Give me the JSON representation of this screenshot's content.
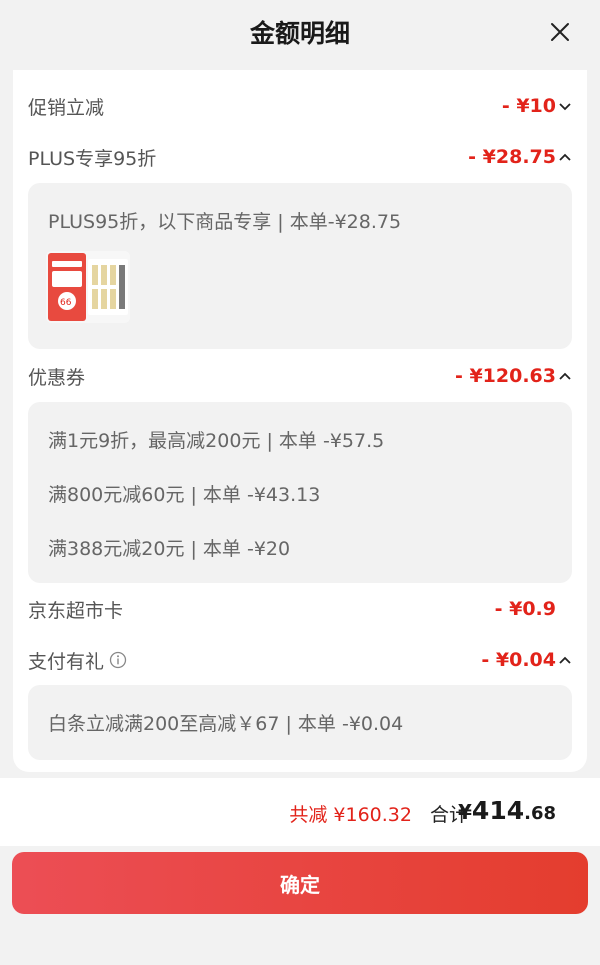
{
  "header": {
    "title": "金额明细",
    "close_icon": "close-icon"
  },
  "promo": {
    "label": "促销立减",
    "amount": "- ¥10"
  },
  "plus": {
    "label": "PLUS专享95折",
    "amount": "- ¥28.75",
    "detail": "PLUS95折，以下商品专享 | 本单-¥28.75",
    "thumb_badge": "66"
  },
  "coupon": {
    "label": "优惠券",
    "amount": "- ¥120.63",
    "lines": [
      "满1元9折，最高减200元 | 本单 -¥57.5",
      "满800元减60元 | 本单 -¥43.13",
      "满388元减20元 | 本单 -¥20"
    ]
  },
  "supermarket_card": {
    "label": "京东超市卡",
    "amount": "- ¥0.9"
  },
  "payment_gift": {
    "label": "支付有礼",
    "amount": "- ¥0.04",
    "detail": "白条立减满200至高减￥67 | 本单 -¥0.04"
  },
  "footer": {
    "saved": "共减 ¥160.32",
    "total_label": "合计",
    "total_currency": "¥",
    "total_integer": "414",
    "total_decimal": ".68"
  },
  "confirm_label": "确定",
  "colors": {
    "accent": "#e2231a",
    "button_start": "#ec4e55",
    "button_end": "#e43d2e"
  }
}
